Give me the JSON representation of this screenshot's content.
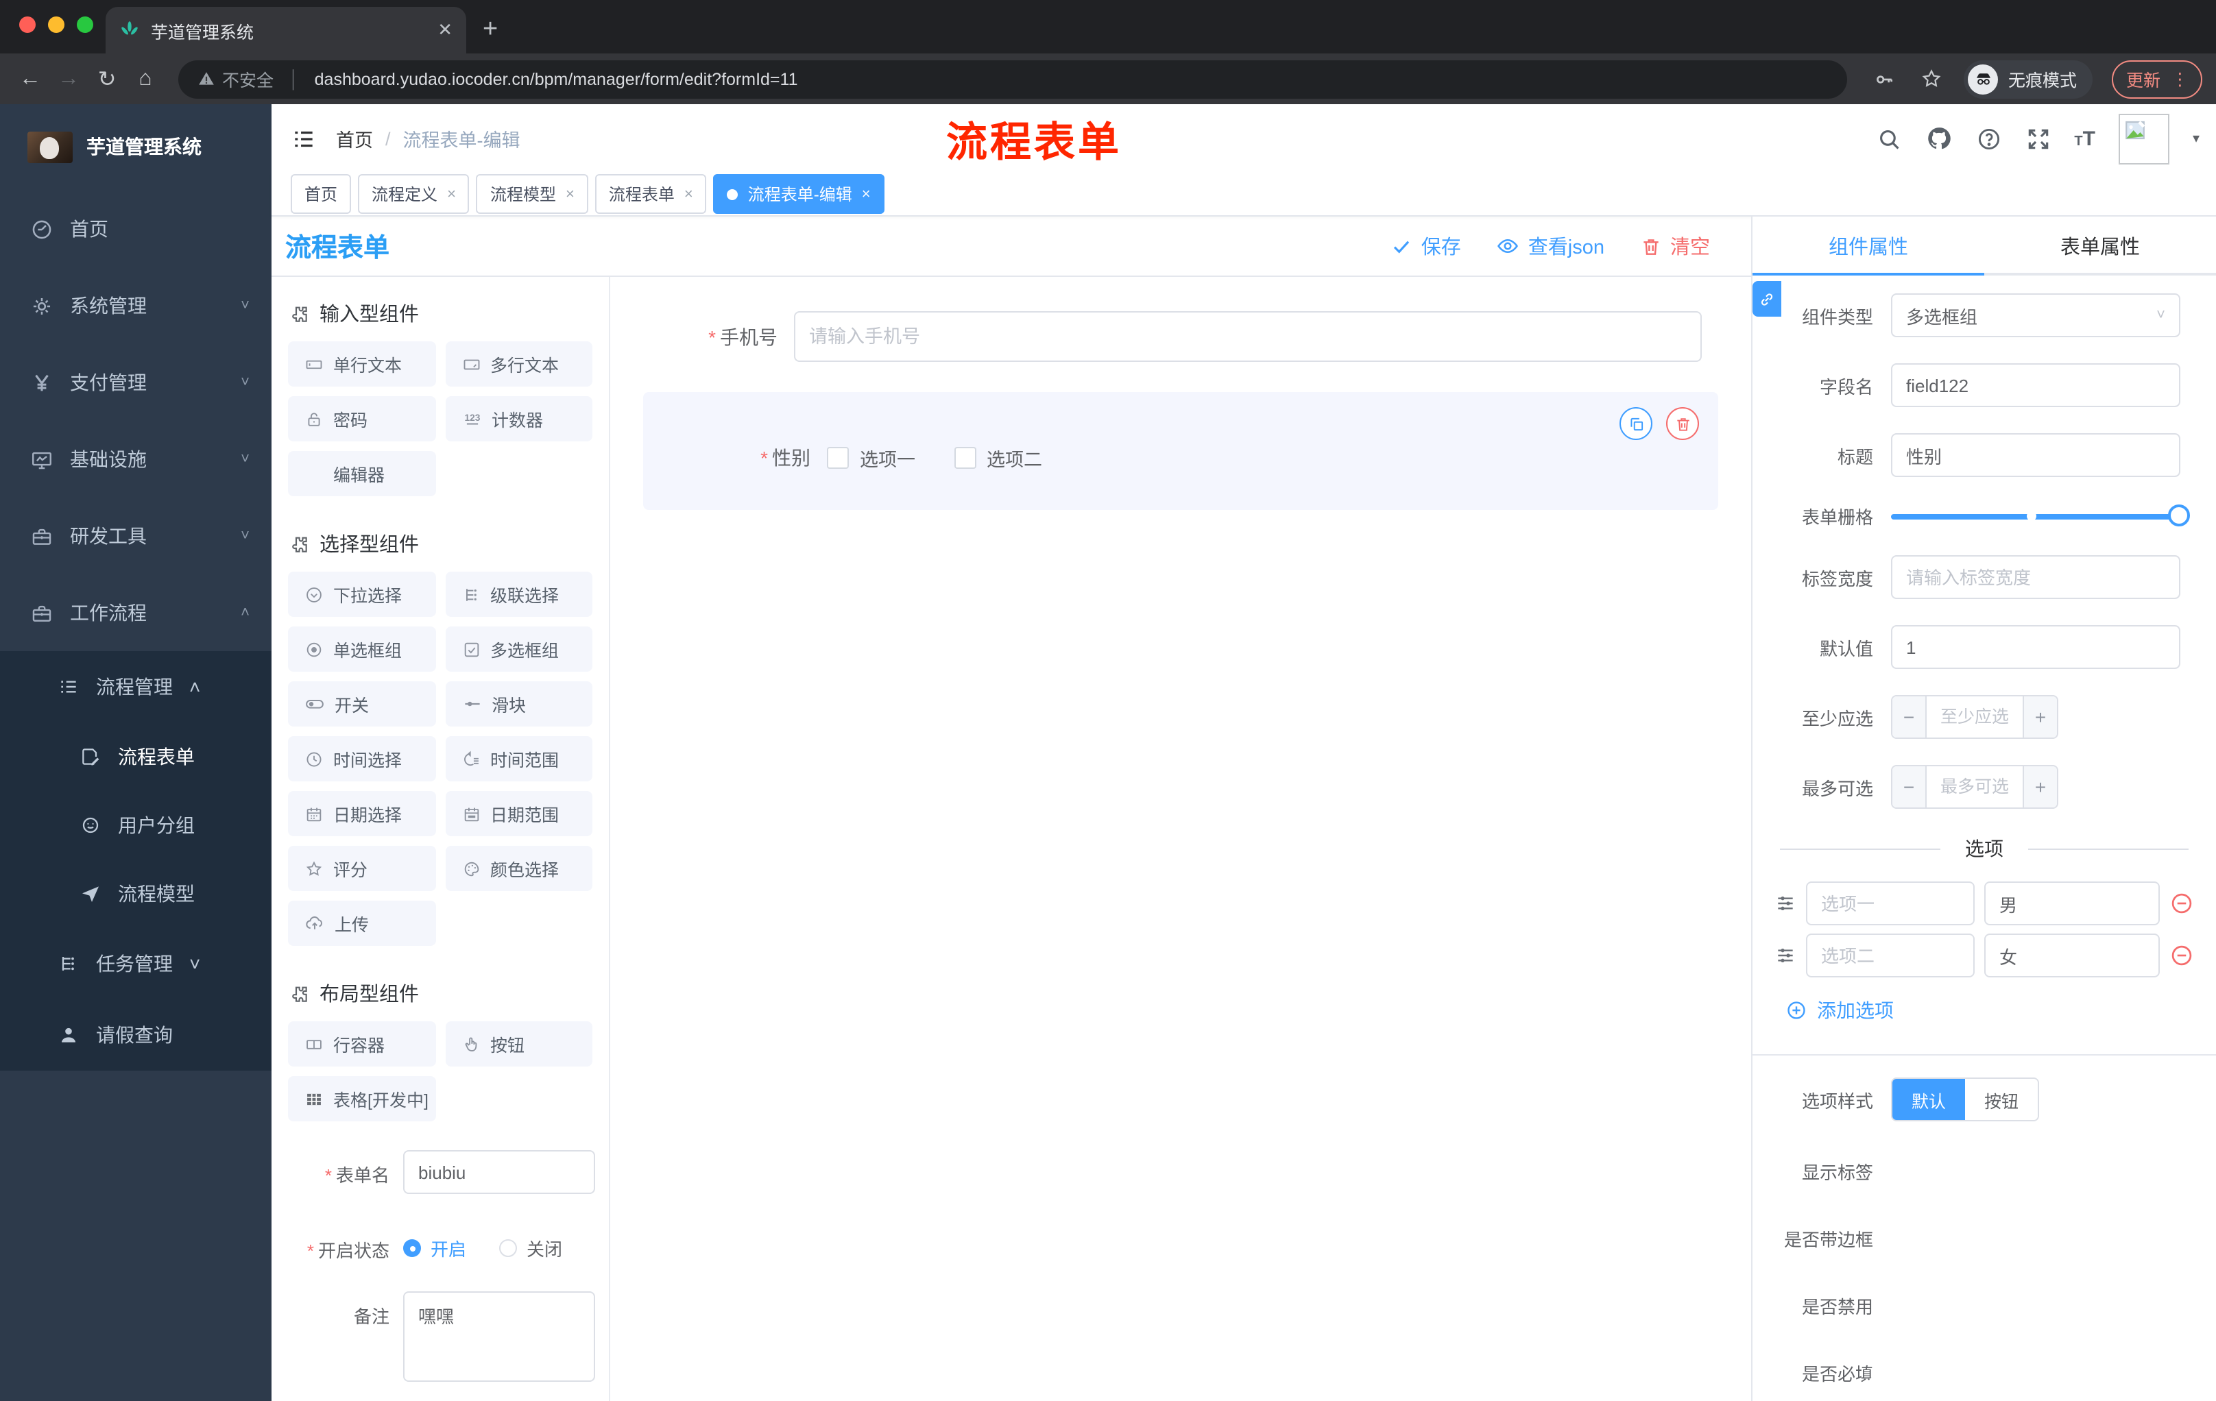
{
  "browser": {
    "tab_title": "芋道管理系统",
    "close_tab": "✕",
    "new_tab": "+",
    "back": "←",
    "forward": "→",
    "reload": "↻",
    "home": "⌂",
    "security_label": "不安全",
    "url": "dashboard.yudao.iocoder.cn/bpm/manager/form/edit?formId=11",
    "incognito_label": "无痕模式",
    "update_label": "更新",
    "menu_dots": "⋮",
    "caret": "▾"
  },
  "annotation": {
    "title": "流程表单"
  },
  "header": {
    "breadcrumb_home": "首页",
    "breadcrumb_sep": "/",
    "breadcrumb_current": "流程表单-编辑"
  },
  "sidebar": {
    "app_title": "芋道管理系统",
    "menu": [
      "首页",
      "系统管理",
      "支付管理",
      "基础设施",
      "研发工具",
      "工作流程"
    ],
    "submenu_parent": "流程管理",
    "submenu": [
      "流程表单",
      "用户分组",
      "流程模型"
    ],
    "siblings": [
      "任务管理",
      "请假查询"
    ]
  },
  "tabs": {
    "items": [
      "首页",
      "流程定义",
      "流程模型",
      "流程表单",
      "流程表单-编辑"
    ]
  },
  "designer": {
    "title": "流程表单",
    "toolbar": {
      "save": "保存",
      "view_json": "查看json",
      "clear": "清空"
    },
    "groups": [
      {
        "title": "输入型组件",
        "items": [
          "单行文本",
          "多行文本",
          "密码",
          "计数器",
          "编辑器"
        ]
      },
      {
        "title": "选择型组件",
        "items": [
          "下拉选择",
          "级联选择",
          "单选框组",
          "多选框组",
          "开关",
          "滑块",
          "时间选择",
          "时间范围",
          "日期选择",
          "日期范围",
          "评分",
          "颜色选择",
          "上传"
        ]
      },
      {
        "title": "布局型组件",
        "items": [
          "行容器",
          "按钮",
          "表格[开发中]"
        ]
      }
    ],
    "meta": {
      "name_label": "表单名",
      "name_value": "biubiu",
      "status_label": "开启状态",
      "status_on": "开启",
      "status_off": "关闭",
      "remark_label": "备注",
      "remark_value": "嘿嘿"
    },
    "canvas": {
      "phone_label": "手机号",
      "phone_placeholder": "请输入手机号",
      "gender_label": "性别",
      "gender_opt1": "选项一",
      "gender_opt2": "选项二"
    }
  },
  "props": {
    "tab_component": "组件属性",
    "tab_form": "表单属性",
    "type_label": "组件类型",
    "type_value": "多选框组",
    "field_label": "字段名",
    "field_value": "field122",
    "title_label": "标题",
    "title_value": "性别",
    "grid_label": "表单栅格",
    "label_width_label": "标签宽度",
    "label_width_placeholder": "请输入标签宽度",
    "default_label": "默认值",
    "default_value": "1",
    "min_label": "至少应选",
    "min_placeholder": "至少应选",
    "max_label": "最多可选",
    "max_placeholder": "最多可选",
    "options_divider": "选项",
    "option_rows": [
      {
        "label": "选项一",
        "value": "男"
      },
      {
        "label": "选项二",
        "value": "女"
      }
    ],
    "add_option": "添加选项",
    "style_label": "选项样式",
    "style_default": "默认",
    "style_button": "按钮",
    "switch_show_label": "显示标签",
    "switch_border": "是否带边框",
    "switch_disabled": "是否禁用",
    "switch_required": "是否必填"
  },
  "colors": {
    "primary": "#409eff",
    "designer_title": "#2b9ef5",
    "danger": "#f56c6c",
    "sidebar_bg": "#2d3a4b",
    "submenu_bg": "#1f2d3d",
    "active_tab": "#409eff",
    "annotation_red": "#ff2600",
    "update_pill": "#f28b82"
  }
}
